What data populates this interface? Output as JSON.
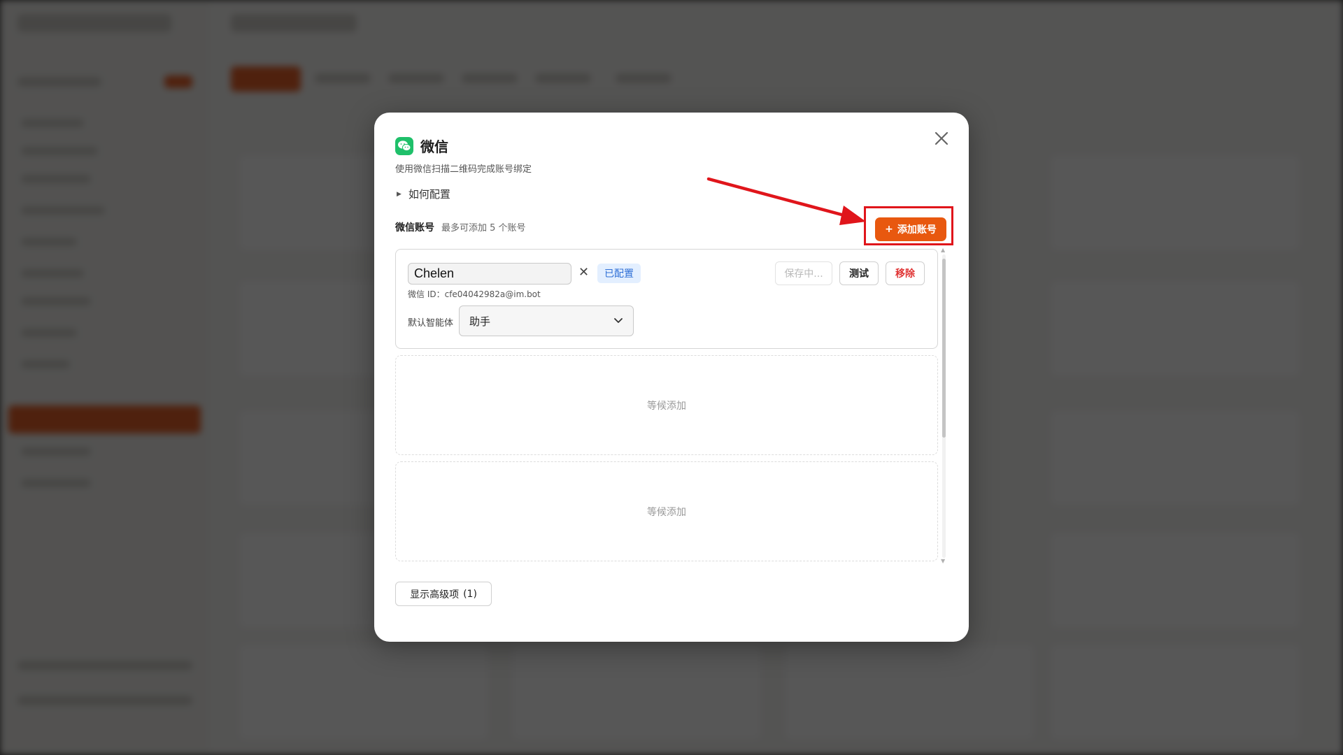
{
  "modal": {
    "title": "微信",
    "subtitle": "使用微信扫描二维码完成账号绑定",
    "howto_label": "如何配置",
    "accounts_label": "微信账号",
    "accounts_hint": "最多可添加 5 个账号",
    "add_button": "添加账号",
    "add_icon": "+",
    "account": {
      "name_value": "Chelen",
      "status_badge": "已配置",
      "wechat_id": "微信 ID：cfe04042982a@im.bot",
      "agent_label": "默认智能体",
      "agent_value": "助手",
      "saving_button": "保存中...",
      "test_button": "测试",
      "remove_button": "移除"
    },
    "empty_slots": [
      "等候添加",
      "等候添加"
    ],
    "advanced_button": "显示高级项",
    "advanced_count": "(1)"
  },
  "colors": {
    "accent": "#e8580f",
    "highlight": "#e0151b",
    "badge_bg": "#e3efff",
    "badge_text": "#2f6fd6",
    "danger": "#e03535",
    "wechat": "#1fc06a"
  },
  "icons": {
    "close": "close-icon",
    "logo": "wechat-logo-icon",
    "disclosure": "triangle-right-icon",
    "clear": "clear-x-icon",
    "dropdown": "chevron-down-icon",
    "arrow": "annotation-arrow"
  }
}
